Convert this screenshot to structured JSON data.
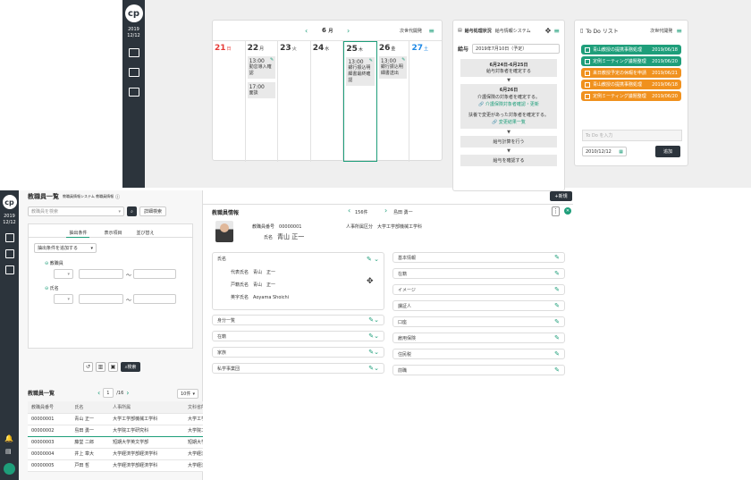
{
  "app": {
    "logo": "cp",
    "date_year": "2019",
    "date_md": "12/12"
  },
  "calendar": {
    "month": "6",
    "month_unit": "月",
    "title": "次世代開発",
    "days": [
      {
        "num": "21",
        "dow": "日",
        "color": "#e53935"
      },
      {
        "num": "22",
        "dow": "月",
        "color": "#333"
      },
      {
        "num": "23",
        "dow": "火",
        "color": "#333"
      },
      {
        "num": "24",
        "dow": "水",
        "color": "#333"
      },
      {
        "num": "25",
        "dow": "木",
        "color": "#333"
      },
      {
        "num": "26",
        "dow": "金",
        "color": "#333"
      },
      {
        "num": "27",
        "dow": "土",
        "color": "#1e88e5"
      }
    ],
    "events": {
      "mon": [
        {
          "time": "13:00",
          "text": "勤怠導入確認"
        },
        {
          "time": "17:00",
          "text": "面談"
        }
      ],
      "thu": [
        {
          "time": "13:00",
          "text": "銀行振込明細書最終確認"
        }
      ],
      "fri": [
        {
          "time": "13:00",
          "text": "銀行振込明細書送出"
        }
      ]
    }
  },
  "payroll": {
    "title": "給与処理状況",
    "system": "給与情報システム",
    "label": "給与",
    "date": "2019年7月10日（予定）",
    "step1_date": "6月24日-6月25日",
    "step1": "給与対象者を確定する",
    "step2_date": "6月26日",
    "step2": "介護保険の対象者を確定する。",
    "step2_link": "介護保険対象者確認・更新",
    "step2b": "扶養で変更があった対象者を確定する。",
    "step2b_link": "変更結果一覧",
    "step3": "給与計算を行う",
    "step4": "給与を確認する"
  },
  "todo": {
    "title": "To Do リスト",
    "team": "次世代開発",
    "items": [
      {
        "text": "青山教授の提携事務処理",
        "date": "2019/06/18",
        "color": "#1e9e7a"
      },
      {
        "text": "定例ミーティング議題整理",
        "date": "2019/06/20",
        "color": "#1e9e7a"
      },
      {
        "text": "来日教授予定の休暇を申請",
        "date": "2019/06/21",
        "color": "#f0911e"
      },
      {
        "text": "青山教授の提携事務処理",
        "date": "2019/06/18",
        "color": "#f0911e"
      },
      {
        "text": "定例ミーティング議題整理",
        "date": "2019/06/20",
        "color": "#f0911e"
      }
    ],
    "placeholder": "To Do を入力",
    "date": "2010/12/12",
    "add": "追加"
  },
  "staff": {
    "title": "教職員一覧",
    "subtitle": "教職員情報システム 教職員情報",
    "search_placeholder": "教職員を検索",
    "detail_search": "詳細検索",
    "tabs": [
      "抽出条件",
      "表示項目",
      "並び替え"
    ],
    "add_condition": "抽出条件を追加する",
    "field1": "教職員",
    "field2": "氏名",
    "tilde": "～",
    "search_btn": "検索",
    "list_title": "教職員一覧",
    "page": "1",
    "pages": "/16",
    "per_page": "10件",
    "columns": [
      "教職員番号",
      "氏名",
      "人事所属",
      "文科省所属"
    ],
    "rows": [
      [
        "00000001",
        "青山 正一",
        "大学工学部機械工学科",
        "大学工学部機"
      ],
      [
        "00000002",
        "島田 勇一",
        "大学院工学研究科",
        "大学院工学研"
      ],
      [
        "00000003",
        "藤堂 二郎",
        "短期大学英文学部",
        "短期大学英文"
      ],
      [
        "00000004",
        "井上 章大",
        "大学経済学部経済学科",
        "大学経済学部"
      ],
      [
        "00000005",
        "戸田 哲",
        "大学経済学部経済学科",
        "大学経済学部"
      ]
    ]
  },
  "detail": {
    "title": "教職員情報",
    "count": "156件",
    "current": "島田 勇一",
    "new_btn": "新規",
    "staff_no_label": "教職員番号",
    "staff_no": "00000001",
    "dept_label": "人事所属区分",
    "dept": "大学工学部機械工学科",
    "name_label": "氏名",
    "name": "青山 正一",
    "name_section": "氏名",
    "rep_label": "代表氏名",
    "rep": "青山　正一",
    "reg_label": "戸籍氏名",
    "reg": "青山　正一",
    "en_label": "英字氏名",
    "en": "Aoyama Shoichi",
    "left_sections": [
      "身分一覧",
      "在籍",
      "家族",
      "私学事業団"
    ],
    "right_sections": [
      "基本情報",
      "在籍",
      "イメージ",
      "課証人",
      "口座",
      "雇用保険",
      "住民税",
      "前職"
    ]
  }
}
